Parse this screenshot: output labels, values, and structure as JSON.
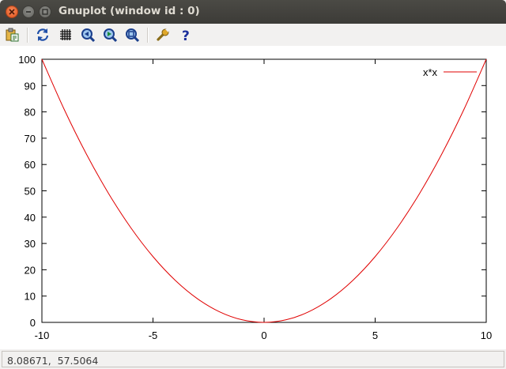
{
  "window": {
    "title": "Gnuplot (window id : 0)"
  },
  "toolbar": {
    "items": [
      {
        "name": "copy-to-clipboard",
        "icon": "clipboard-icon"
      },
      {
        "name": "replot",
        "icon": "replot-icon"
      },
      {
        "name": "toggle-grid",
        "icon": "grid-icon"
      },
      {
        "name": "previous-zoom",
        "icon": "zoom-previous-icon"
      },
      {
        "name": "next-zoom",
        "icon": "zoom-next-icon"
      },
      {
        "name": "autoscale",
        "icon": "zoom-autoscale-icon"
      },
      {
        "name": "settings",
        "icon": "wrench-icon"
      },
      {
        "name": "help",
        "icon": "help-icon"
      }
    ]
  },
  "status": {
    "text": "8.08671,  57.5064"
  },
  "colors": {
    "curve": "#e00000",
    "axis": "#000000",
    "titlebar": "#3c3b37"
  },
  "chart_data": {
    "type": "line",
    "title": "",
    "xlabel": "",
    "ylabel": "",
    "xlim": [
      -10,
      10
    ],
    "ylim": [
      0,
      100
    ],
    "xticks": [
      -10,
      -5,
      0,
      5,
      10
    ],
    "yticks": [
      0,
      10,
      20,
      30,
      40,
      50,
      60,
      70,
      80,
      90,
      100
    ],
    "grid": false,
    "legend_position": "top-right",
    "series": [
      {
        "name": "x*x",
        "color": "#e00000",
        "x": [
          -10,
          -9,
          -8,
          -7,
          -6,
          -5,
          -4,
          -3,
          -2,
          -1,
          0,
          1,
          2,
          3,
          4,
          5,
          6,
          7,
          8,
          9,
          10
        ],
        "y": [
          100,
          81,
          64,
          49,
          36,
          25,
          16,
          9,
          4,
          1,
          0,
          1,
          4,
          9,
          16,
          25,
          36,
          49,
          64,
          81,
          100
        ]
      }
    ]
  }
}
